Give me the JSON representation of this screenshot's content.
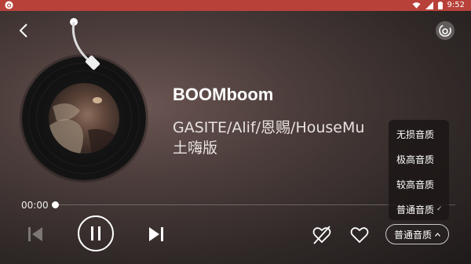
{
  "status_bar": {
    "time": "9:52",
    "icons": [
      "netease-cloud-icon",
      "wifi-icon",
      "signal-icon",
      "battery-icon"
    ]
  },
  "toolbar": {
    "back_icon": "chevron-left-icon",
    "brand_icon": "netease-logo-icon"
  },
  "song": {
    "title": "BOOMboom",
    "artist": "GASITE/Alif/恩赐/HouseMu",
    "artist_line2": "土嗨版"
  },
  "progress": {
    "current_time": "00:00",
    "fraction": 0.0
  },
  "controls": {
    "prev_icon": "skip-previous-icon",
    "play_state": "playing",
    "pause_icon": "pause-icon",
    "next_icon": "skip-next-icon",
    "noloop_icon": "heart-slash-icon",
    "like_icon": "heart-icon",
    "quality_label": "普通音质"
  },
  "quality_menu": {
    "items": [
      {
        "label": "无损音质",
        "selected": false
      },
      {
        "label": "极高音质",
        "selected": false
      },
      {
        "label": "较高音质",
        "selected": false
      },
      {
        "label": "普通音质",
        "selected": true
      }
    ]
  },
  "colors": {
    "status_bar": "#b8413a",
    "accent": "#ffffff"
  }
}
